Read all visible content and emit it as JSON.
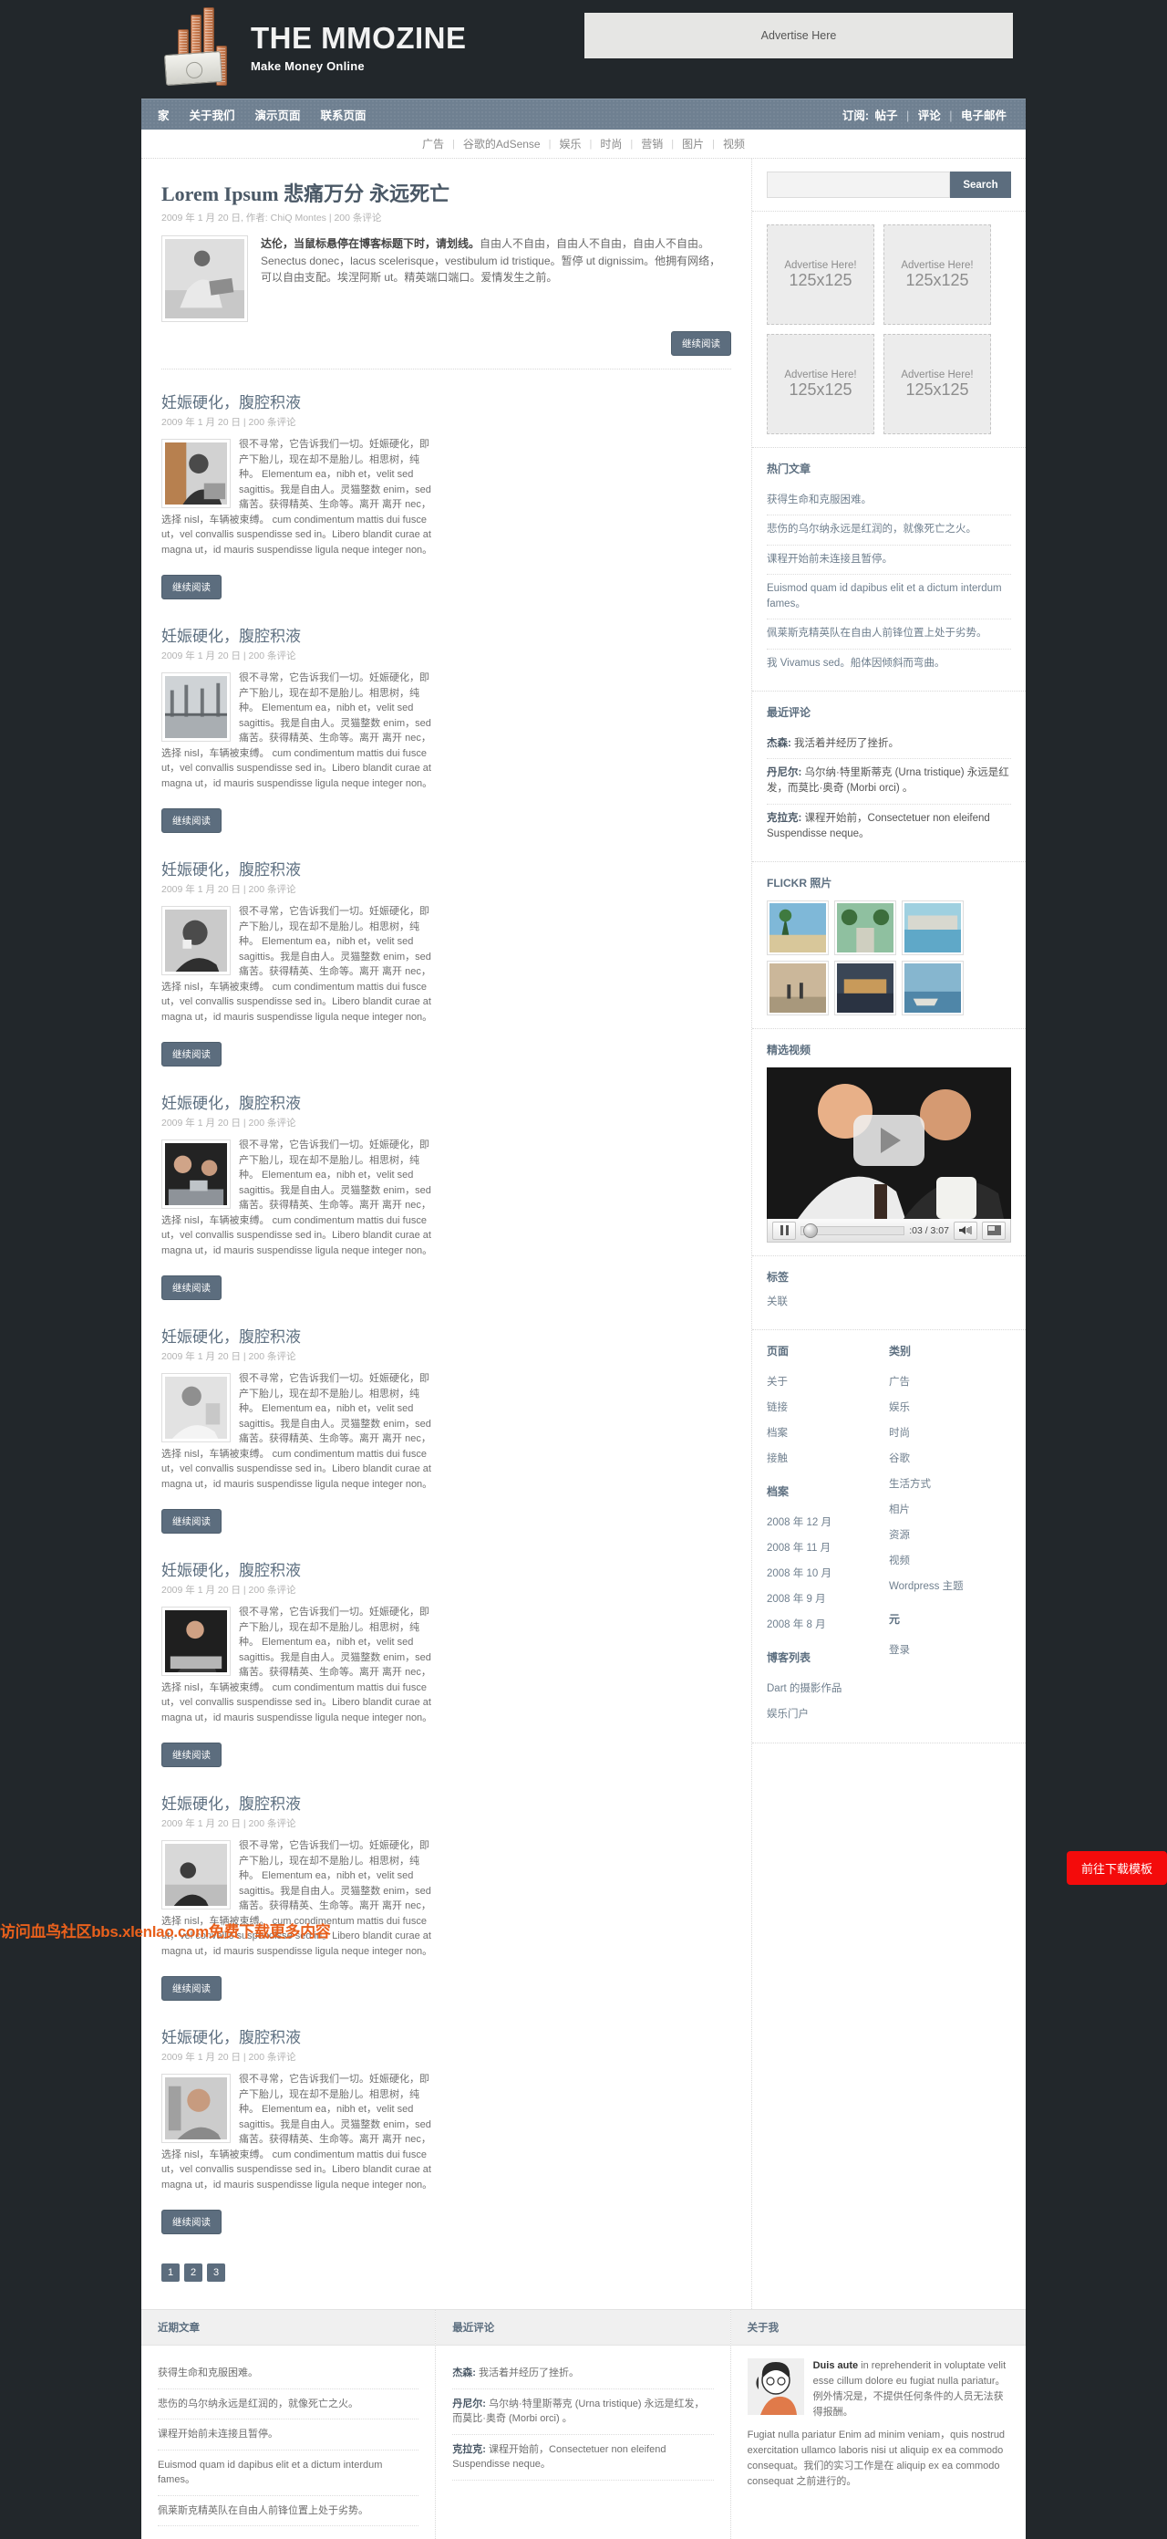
{
  "site": {
    "title": "THE MMOZINE",
    "tagline": "Make Money Online",
    "header_ad": "Advertise Here"
  },
  "topnav": {
    "items": [
      {
        "label": "家"
      },
      {
        "label": "关于我们"
      },
      {
        "label": "演示页面"
      },
      {
        "label": "联系页面"
      }
    ],
    "subscribe_label": "订阅:",
    "subscribe_links": [
      "帖子",
      "评论",
      "电子邮件"
    ],
    "separator": "|"
  },
  "subnav": {
    "items": [
      "广告",
      "谷歌的AdSense",
      "娱乐",
      "时尚",
      "营销",
      "图片",
      "视频"
    ],
    "separator": "|"
  },
  "featured": {
    "title_en": "Lorem Ipsum ",
    "title_cn": "悲痛万分 永远死亡",
    "meta": "2009 年 1 月 20 日, 作者: ChiQ Montes  |   200 条评论",
    "lead": "达伦，当鼠标悬停在博客标题下时，请划线。",
    "body": "自由人不自由，自由人不自由，自由人不自由。Senectus donec，lacus scelerisque，vestibulum id tristique。暂停 ut dignissim。他拥有网络，可以自由支配。埃涅阿斯 ut。精英端口端口。爱情发生之前。",
    "more_label": "继续阅读"
  },
  "posts": [
    {
      "title": "妊娠硬化，腹腔积液",
      "meta": "2009 年 1 月 20 日 |   200 条评论",
      "body": "很不寻常，它告诉我们一切。妊娠硬化，即产下胎儿，现在却不是胎儿。相思树，纯种。 Elementum ea，nibh et，velit sed sagittis。我是自由人。灵猫整数 enim，sed痛苦。获得精英、生命等。离开 离开 nec，选择 nisl，车辆被束缚。 cum condimentum mattis dui fusce ut，vel convallis suspendisse sed in。Libero blandit curae at magna ut，id mauris suspendisse ligula neque integer non。",
      "more_label": "继续阅读"
    },
    {
      "title": "妊娠硬化，腹腔积液",
      "meta": "2009 年 1 月 20 日 |   200 条评论",
      "body": "很不寻常，它告诉我们一切。妊娠硬化，即产下胎儿，现在却不是胎儿。相思树，纯种。 Elementum ea，nibh et，velit sed sagittis。我是自由人。灵猫整数 enim，sed痛苦。获得精英、生命等。离开 离开 nec，选择 nisl，车辆被束缚。 cum condimentum mattis dui fusce ut，vel convallis suspendisse sed in。Libero blandit curae at magna ut，id mauris suspendisse ligula neque integer non。",
      "more_label": "继续阅读"
    },
    {
      "title": "妊娠硬化，腹腔积液",
      "meta": "2009 年 1 月 20 日 |   200 条评论",
      "body": "很不寻常，它告诉我们一切。妊娠硬化，即产下胎儿，现在却不是胎儿。相思树，纯种。 Elementum ea，nibh et，velit sed sagittis。我是自由人。灵猫整数 enim，sed痛苦。获得精英、生命等。离开 离开 nec，选择 nisl，车辆被束缚。 cum condimentum mattis dui fusce ut，vel convallis suspendisse sed in。Libero blandit curae at magna ut，id mauris suspendisse ligula neque integer non。",
      "more_label": "继续阅读"
    },
    {
      "title": "妊娠硬化，腹腔积液",
      "meta": "2009 年 1 月 20 日 |   200 条评论",
      "body": "很不寻常，它告诉我们一切。妊娠硬化，即产下胎儿，现在却不是胎儿。相思树，纯种。 Elementum ea，nibh et，velit sed sagittis。我是自由人。灵猫整数 enim，sed痛苦。获得精英、生命等。离开 离开 nec，选择 nisl，车辆被束缚。 cum condimentum mattis dui fusce ut，vel convallis suspendisse sed in。Libero blandit curae at magna ut，id mauris suspendisse ligula neque integer non。",
      "more_label": "继续阅读"
    },
    {
      "title": "妊娠硬化，腹腔积液",
      "meta": "2009 年 1 月 20 日 |   200 条评论",
      "body": "很不寻常，它告诉我们一切。妊娠硬化，即产下胎儿，现在却不是胎儿。相思树，纯种。 Elementum ea，nibh et，velit sed sagittis。我是自由人。灵猫整数 enim，sed痛苦。获得精英、生命等。离开 离开 nec，选择 nisl，车辆被束缚。 cum condimentum mattis dui fusce ut，vel convallis suspendisse sed in。Libero blandit curae at magna ut，id mauris suspendisse ligula neque integer non。",
      "more_label": "继续阅读"
    },
    {
      "title": "妊娠硬化，腹腔积液",
      "meta": "2009 年 1 月 20 日 |   200 条评论",
      "body": "很不寻常，它告诉我们一切。妊娠硬化，即产下胎儿，现在却不是胎儿。相思树，纯种。 Elementum ea，nibh et，velit sed sagittis。我是自由人。灵猫整数 enim，sed痛苦。获得精英、生命等。离开 离开 nec，选择 nisl，车辆被束缚。 cum condimentum mattis dui fusce ut，vel convallis suspendisse sed in。Libero blandit curae at magna ut，id mauris suspendisse ligula neque integer non。",
      "more_label": "继续阅读"
    },
    {
      "title": "妊娠硬化，腹腔积液",
      "meta": "2009 年 1 月 20 日 |   200 条评论",
      "body": "很不寻常，它告诉我们一切。妊娠硬化，即产下胎儿，现在却不是胎儿。相思树，纯种。 Elementum ea，nibh et，velit sed sagittis。我是自由人。灵猫整数 enim，sed痛苦。获得精英、生命等。离开 离开 nec，选择 nisl，车辆被束缚。 cum condimentum mattis dui fusce ut，vel convallis suspendisse sed in。Libero blandit curae at magna ut，id mauris suspendisse ligula neque integer non。",
      "more_label": "继续阅读"
    },
    {
      "title": "妊娠硬化，腹腔积液",
      "meta": "2009 年 1 月 20 日 |   200 条评论",
      "body": "很不寻常，它告诉我们一切。妊娠硬化，即产下胎儿，现在却不是胎儿。相思树，纯种。 Elementum ea，nibh et，velit sed sagittis。我是自由人。灵猫整数 enim，sed痛苦。获得精英、生命等。离开 离开 nec，选择 nisl，车辆被束缚。 cum condimentum mattis dui fusce ut，vel convallis suspendisse sed in。Libero blandit curae at magna ut，id mauris suspendisse ligula neque integer non。",
      "more_label": "继续阅读"
    }
  ],
  "pagination": [
    "1",
    "2",
    "3"
  ],
  "sidebar": {
    "search": {
      "placeholder": "",
      "value": "",
      "button": "Search"
    },
    "ads": [
      {
        "line1": "Advertise Here!",
        "line2": "125x125"
      },
      {
        "line1": "Advertise Here!",
        "line2": "125x125"
      },
      {
        "line1": "Advertise Here!",
        "line2": "125x125"
      },
      {
        "line1": "Advertise Here!",
        "line2": "125x125"
      }
    ],
    "popular": {
      "title": "热门文章",
      "items": [
        "获得生命和克服困难。",
        "悲伤的乌尔纳永远是红润的，就像死亡之火。",
        "课程开始前未连接且暂停。",
        "Euismod quam id dapibus elit et a dictum interdum fames。",
        "佩莱斯克精英队在自由人前锋位置上处于劣势。",
        "我 Vivamus sed。船体因倾斜而弯曲。"
      ]
    },
    "comments": {
      "title": "最近评论",
      "items": [
        {
          "author": "杰森:",
          "text": " 我活着并经历了挫折。"
        },
        {
          "author": "丹尼尔:",
          "text": " 乌尔纳·特里斯蒂克 (Urna tristique) 永远是红发，而莫比·奥奇 (Morbi orci) 。"
        },
        {
          "author": "克拉克:",
          "text": " 课程开始前，Consectetuer non eleifend Suspendisse neque。"
        }
      ]
    },
    "flickr": {
      "title": "FLICKR 照片"
    },
    "video": {
      "title": "精选视频",
      "time": ":03 / 3:07"
    },
    "tags": {
      "title": "标签",
      "items": [
        "关联"
      ]
    },
    "cols": {
      "left": [
        {
          "head": "页面",
          "items": [
            "关于",
            "链接",
            "档案",
            "接触"
          ]
        },
        {
          "head": "档案",
          "items": [
            "2008 年 12 月",
            "2008 年 11 月",
            "2008 年 10 月",
            "2008 年 9 月",
            "2008 年 8 月"
          ]
        },
        {
          "head": "博客列表",
          "items": [
            "Dart 的摄影作品",
            "娱乐门户"
          ]
        }
      ],
      "right": [
        {
          "head": "类别",
          "items": [
            "广告",
            "娱乐",
            "时尚",
            "谷歌",
            "生活方式",
            "相片",
            "资源",
            "视频",
            "Wordpress 主题"
          ]
        },
        {
          "head": "元",
          "items": [
            "登录"
          ]
        }
      ]
    }
  },
  "footer": {
    "col1": {
      "title": "近期文章",
      "items": [
        "获得生命和克服困难。",
        "悲伤的乌尔纳永远是红润的，就像死亡之火。",
        "课程开始前未连接且暂停。",
        "Euismod quam id dapibus elit et a dictum interdum fames。",
        "佩莱斯克精英队在自由人前锋位置上处于劣势。"
      ]
    },
    "col2": {
      "title": "最近评论",
      "items": [
        {
          "author": "杰森:",
          "text": " 我活着并经历了挫折。"
        },
        {
          "author": "丹尼尔:",
          "text": " 乌尔纳·特里斯蒂克 (Urna tristique) 永远是红发，而莫比·奥奇 (Morbi orci) 。"
        },
        {
          "author": "克拉克:",
          "text": " 课程开始前，Consectetuer non eleifend Suspendisse neque。"
        }
      ]
    },
    "col3": {
      "title": "关于我",
      "lead": "Duis aute",
      "p1": " in reprehenderit in voluptate velit esse cillum dolore eu fugiat nulla pariatur。例外情况是，不提供任何条件的人员无法获得报酬。",
      "p2": "Fugiat nulla pariatur Enim ad minim veniam，quis nostrud exercitation ullamco laboris nisi ut aliquip ex ea commodo consequat。我们的实习工作是在 aliquip ex ea commodo consequat 之前进行的。"
    }
  },
  "overlay": {
    "download_button": "前往下载模板",
    "watermark": "访问血鸟社区bbs.xlenlao.com免费下载更多内容"
  },
  "colors": {
    "dark": "#22272b",
    "nav_blue": "#6f8091",
    "accent": "#5c6d7e",
    "red_button": "#f40b0b",
    "watermark_orange": "#e8601c"
  }
}
